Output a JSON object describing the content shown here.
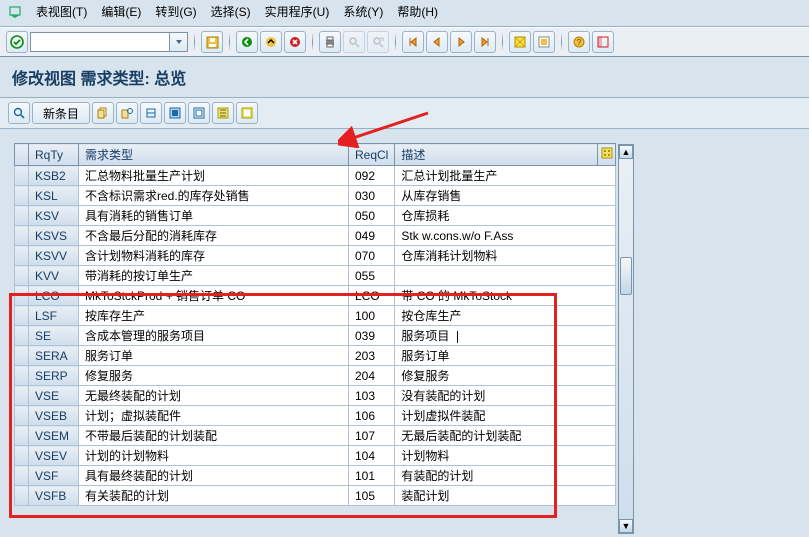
{
  "menu": {
    "table_view": "表视图(T)",
    "edit": "编辑(E)",
    "goto": "转到(G)",
    "select": "选择(S)",
    "utilities": "实用程序(U)",
    "system": "系统(Y)",
    "help": "帮助(H)"
  },
  "title": "修改视图 需求类型: 总览",
  "app_toolbar": {
    "new_entries": "新条目"
  },
  "columns": {
    "rqty": "RqTy",
    "rqtype": "需求类型",
    "reqcl": "ReqCl",
    "desc": "描述"
  },
  "rows": [
    {
      "rqty": "KSB2",
      "name": "汇总物料批量生产计划",
      "cl": "092",
      "desc": "汇总计划批量生产"
    },
    {
      "rqty": "KSL",
      "name": "不含标识需求red.的库存处销售",
      "cl": "030",
      "desc": "从库存销售"
    },
    {
      "rqty": "KSV",
      "name": "具有消耗的销售订单",
      "cl": "050",
      "desc": "仓库损耗"
    },
    {
      "rqty": "KSVS",
      "name": "不含最后分配的消耗库存",
      "cl": "049",
      "desc": "Stk w.cons.w/o F.Ass"
    },
    {
      "rqty": "KSVV",
      "name": "含计划物料消耗的库存",
      "cl": "070",
      "desc": "仓库消耗计划物料"
    },
    {
      "rqty": "KVV",
      "name": "带消耗的按订单生产",
      "cl": "055",
      "desc": ""
    },
    {
      "rqty": "LCO",
      "name": "MkToStckProd + 销售订单 CO",
      "cl": "LCO",
      "desc": "带 CO 的 MkToStock"
    },
    {
      "rqty": "LSF",
      "name": "按库存生产",
      "cl": "100",
      "desc": "按仓库生产"
    },
    {
      "rqty": "SE",
      "name": "含成本管理的服务项目",
      "cl": "039",
      "desc": "服务项目"
    },
    {
      "rqty": "SERA",
      "name": "服务订单",
      "cl": "203",
      "desc": "服务订单"
    },
    {
      "rqty": "SERP",
      "name": "修复服务",
      "cl": "204",
      "desc": "修复服务"
    },
    {
      "rqty": "VSE",
      "name": "无最终装配的计划",
      "cl": "103",
      "desc": "没有装配的计划"
    },
    {
      "rqty": "VSEB",
      "name": "计划；虚拟装配件",
      "cl": "106",
      "desc": "计划虚拟件装配"
    },
    {
      "rqty": "VSEM",
      "name": "不带最后装配的计划装配",
      "cl": "107",
      "desc": "无最后装配的计划装配"
    },
    {
      "rqty": "VSEV",
      "name": "计划的计划物料",
      "cl": "104",
      "desc": "计划物料"
    },
    {
      "rqty": "VSF",
      "name": "具有最终装配的计划",
      "cl": "101",
      "desc": "有装配的计划"
    },
    {
      "rqty": "VSFB",
      "name": "有关装配的计划",
      "cl": "105",
      "desc": "装配计划"
    }
  ],
  "icons": {
    "check": "✔",
    "save": "💾",
    "back": "◀",
    "exit": "✖",
    "print": "🖨",
    "find": "🔍"
  }
}
